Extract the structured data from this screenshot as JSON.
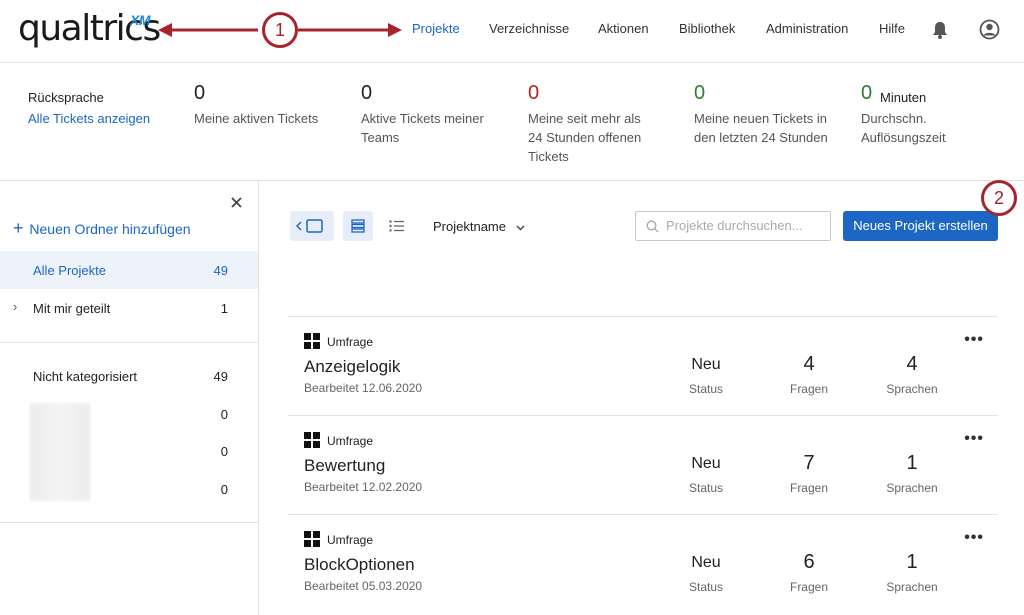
{
  "header": {
    "logo_text": "qualtrics",
    "logo_suffix": "XM",
    "nav": [
      "Projekte",
      "Verzeichnisse",
      "Aktionen",
      "Bibliothek",
      "Administration",
      "Hilfe"
    ],
    "annotation_1": "1",
    "annotation_2": "2"
  },
  "tickets": {
    "label": "Rücksprache",
    "link": "Alle Tickets anzeigen",
    "stats": [
      {
        "value": "0",
        "desc": "Meine aktiven Tickets",
        "color": "#222222"
      },
      {
        "value": "0",
        "desc": "Aktive Tickets meiner Teams",
        "color": "#222222"
      },
      {
        "value": "0",
        "desc": "Meine seit mehr als 24 Stunden offenen Tickets",
        "color": "#b3261e"
      },
      {
        "value": "0",
        "desc": "Meine neuen Tickets in den letzten 24 Stunden",
        "color": "#2e7d32"
      },
      {
        "value": "0",
        "unit": "Minuten",
        "desc": "Durchschn. Auflösungszeit",
        "color": "#2e7d32"
      }
    ]
  },
  "sidebar": {
    "add_folder": "Neuen Ordner hinzufügen",
    "items": [
      {
        "label": "Alle Projekte",
        "count": "49"
      },
      {
        "label": "Mit mir geteilt",
        "count": "1"
      },
      {
        "label": "Nicht kategorisiert",
        "count": "49"
      },
      {
        "label": "",
        "count": "0"
      },
      {
        "label": "",
        "count": "0"
      },
      {
        "label": "",
        "count": "0"
      }
    ]
  },
  "toolbar": {
    "sort_label": "Projektname",
    "search_placeholder": "Projekte durchsuchen...",
    "create_button": "Neues Projekt erstellen"
  },
  "projects": [
    {
      "type": "Umfrage",
      "name": "Anzeigelogik",
      "edited": "Bearbeitet 12.06.2020",
      "status": "Neu",
      "status_label": "Status",
      "questions": "4",
      "questions_label": "Fragen",
      "languages": "4",
      "languages_label": "Sprachen"
    },
    {
      "type": "Umfrage",
      "name": "Bewertung",
      "edited": "Bearbeitet 12.02.2020",
      "status": "Neu",
      "status_label": "Status",
      "questions": "7",
      "questions_label": "Fragen",
      "languages": "1",
      "languages_label": "Sprachen"
    },
    {
      "type": "Umfrage",
      "name": "BlockOptionen",
      "edited": "Bearbeitet 05.03.2020",
      "status": "Neu",
      "status_label": "Status",
      "questions": "6",
      "questions_label": "Fragen",
      "languages": "1",
      "languages_label": "Sprachen"
    }
  ],
  "colors": {
    "accent": "#1c66c6",
    "annotation": "#a8232c"
  }
}
